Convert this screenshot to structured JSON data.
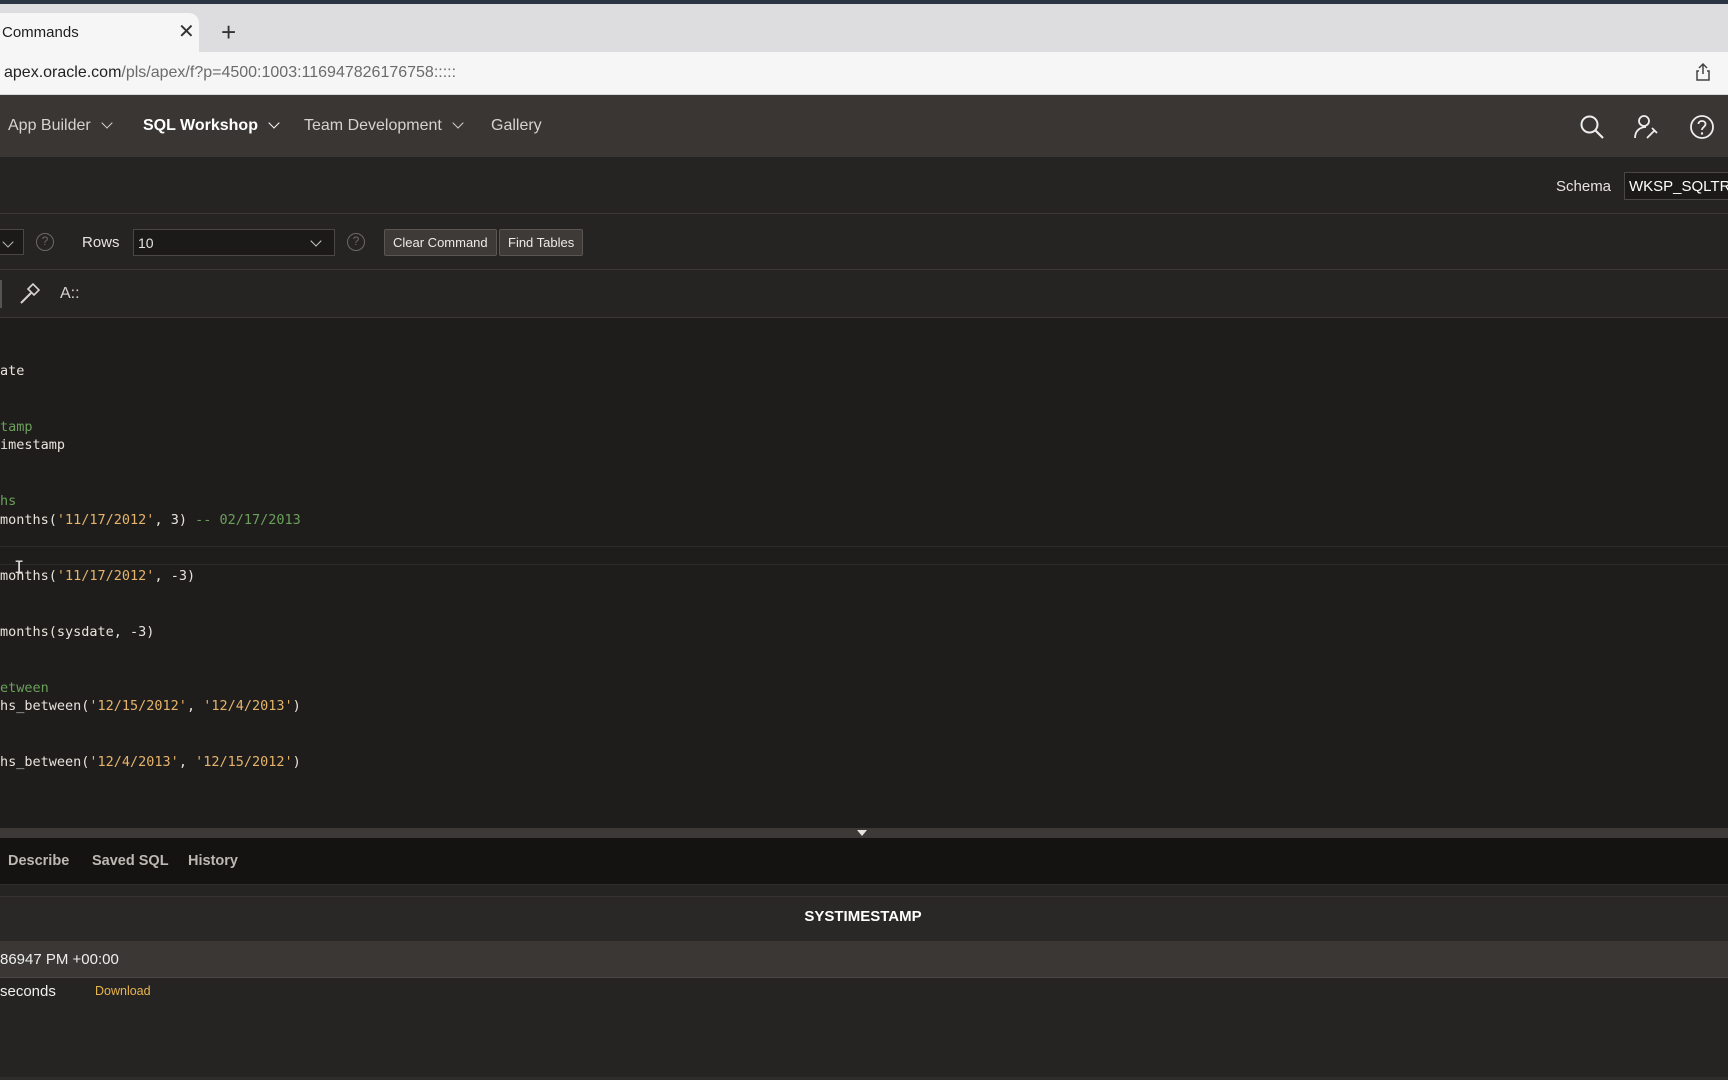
{
  "browser": {
    "tab_title": "Commands",
    "close_glyph": "✕",
    "new_tab_glyph": "+",
    "url_host": "apex.oracle.com",
    "url_path": "/pls/apex/f?p=4500:1003:116947826176758:::::"
  },
  "nav": {
    "items": [
      {
        "label": "App Builder"
      },
      {
        "label": "SQL Workshop"
      },
      {
        "label": "Team Development"
      },
      {
        "label": "Gallery"
      }
    ]
  },
  "schema": {
    "label": "Schema",
    "value": "WKSP_SQLTRAI"
  },
  "options": {
    "help_glyph": "?",
    "rows_label": "Rows",
    "rows_value": "10",
    "clear_button": "Clear Command",
    "find_button": "Find Tables"
  },
  "editor_toolbar": {
    "font_label": "A::"
  },
  "code_lines": [
    {
      "text": "ate",
      "kind": "def"
    },
    {
      "text": "tamp",
      "kind": "com"
    },
    {
      "text": "imestamp",
      "kind": "def"
    },
    {
      "text": "hs",
      "kind": "com"
    },
    {
      "pre": "months(",
      "str": "'11/17/2012'",
      "post": ", 3) ",
      "com": "-- 02/17/2013"
    },
    {
      "pre": "months(",
      "str": "'11/17/2012'",
      "post": ", -3)"
    },
    {
      "text": "months(sysdate, -3)",
      "kind": "def"
    },
    {
      "text": "etween",
      "kind": "com"
    },
    {
      "pre": "hs_between(",
      "str": "'12/15/2012'",
      "mid": ", ",
      "str2": "'12/4/2013'",
      "post": ")"
    },
    {
      "pre": "hs_between(",
      "str": "'12/4/2013'",
      "mid": ", ",
      "str2": "'12/15/2012'",
      "post": ")"
    }
  ],
  "results_tabs": [
    "Describe",
    "Saved SQL",
    "History"
  ],
  "results": {
    "column": "SYSTIMESTAMP",
    "row_value": "86947 PM +00:00",
    "elapsed": "seconds",
    "download": "Download"
  }
}
